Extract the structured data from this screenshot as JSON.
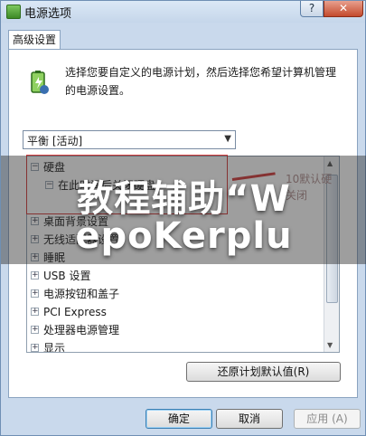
{
  "window": {
    "title": "电源选项",
    "help_label": "?",
    "close_label": "✕"
  },
  "tab": {
    "label": "高级设置"
  },
  "description": "选择您要自定义的电源计划，然后选择您希望计算机管理的电源设置。",
  "plan_select": {
    "value": "平衡 [活动]"
  },
  "tree": {
    "items": [
      {
        "label": "硬盘",
        "expander": "⊟"
      },
      {
        "label": "在此时间后关闭硬盘",
        "expander": "⊟"
      },
      {
        "label": "桌面背景设置",
        "expander": "⊞"
      },
      {
        "label": "无线适配器设置",
        "expander": "⊞"
      },
      {
        "label": "睡眠",
        "expander": "⊞"
      },
      {
        "label": "USB 设置",
        "expander": "⊞"
      },
      {
        "label": "电源按钮和盖子",
        "expander": "⊞"
      },
      {
        "label": "PCI Express",
        "expander": "⊞"
      },
      {
        "label": "处理器电源管理",
        "expander": "⊞"
      },
      {
        "label": "显示",
        "expander": "⊞"
      }
    ]
  },
  "annotation": {
    "line1": "10默认硬",
    "line2": "关闭"
  },
  "buttons": {
    "restore": "还原计划默认值(R)",
    "ok": "确定",
    "cancel": "取消",
    "apply": "应用 (A)"
  },
  "overlay": {
    "line1": "教程辅助“W",
    "line2": "epoKerplu"
  },
  "colors": {
    "accent": "#3c7fb1",
    "annotation": "#d23b3b"
  }
}
